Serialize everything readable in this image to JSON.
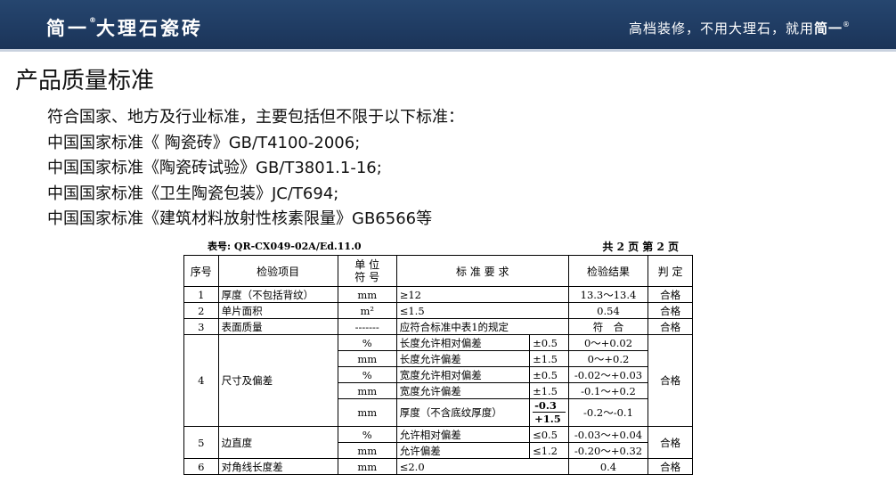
{
  "header": {
    "brand": "简一",
    "brand_tail": "大理石瓷砖",
    "brand_mark": "®",
    "slogan": "高档装修，不用大理石，就用",
    "slogan_brand": "简一",
    "slogan_mark": "®"
  },
  "page_title": "产品质量标准",
  "standards": [
    "符合国家、地方及行业标准，主要包括但不限于以下标准：",
    "中国国家标准《 陶瓷砖》GB/T4100-2006;",
    "中国国家标准《陶瓷砖试验》GB/T3801.1-16;",
    "中国国家标准《卫生陶瓷包装》JC/T694;",
    "中国国家标准《建筑材料放射性核素限量》GB6566等"
  ],
  "report": {
    "form_no": "表号: QR-CX049-02A/Ed.11.0",
    "page_no": "共 2 页 第 2 页",
    "headers": {
      "seq": "序号",
      "item": "检验项目",
      "unit_line1": "单 位",
      "unit_line2": "符 号",
      "requirement": "标 准 要 求",
      "result": "检验结果",
      "judgement": "判 定"
    },
    "rows": {
      "r1": {
        "seq": "1",
        "item": "厚度（不包括背纹）",
        "unit": "mm",
        "requirement": "≥12",
        "result": "13.3～13.4",
        "judgement": "合格"
      },
      "r2": {
        "seq": "2",
        "item": "单片面积",
        "unit": "m²",
        "requirement": "≤1.5",
        "result": "0.54",
        "judgement": "合格"
      },
      "r3": {
        "seq": "3",
        "item": "表面质量",
        "unit": "-------",
        "requirement": "应符合标准中表1的规定",
        "result": "符　合",
        "judgement": "合格"
      },
      "r4": {
        "seq": "4",
        "item": "尺寸及偏差",
        "judgement": "合格",
        "subs": [
          {
            "unit": "%",
            "desc": "长度允许相对偏差",
            "tol": "±0.5",
            "result": "0～+0.02"
          },
          {
            "unit": "mm",
            "desc": "长度允许偏差",
            "tol": "±1.5",
            "result": "0～+0.2"
          },
          {
            "unit": "%",
            "desc": "宽度允许相对偏差",
            "tol": "±0.5",
            "result": "-0.02～+0.03"
          },
          {
            "unit": "mm",
            "desc": "宽度允许偏差",
            "tol": "±1.5",
            "result": "-0.1～+0.2"
          },
          {
            "unit": "mm",
            "desc": "厚度（不含底纹厚度）",
            "tol_top": "-0.3",
            "tol_bottom": "+1.5",
            "result": "-0.2～-0.1"
          }
        ]
      },
      "r5": {
        "seq": "5",
        "item": "边直度",
        "judgement": "合格",
        "subs": [
          {
            "unit": "%",
            "desc": "允许相对偏差",
            "tol": "≤0.5",
            "result": "-0.03～+0.04"
          },
          {
            "unit": "mm",
            "desc": "允许偏差",
            "tol": "≤1.2",
            "result": "-0.20～+0.32"
          }
        ]
      },
      "r6": {
        "seq": "6",
        "item": "对角线长度差",
        "unit": "mm",
        "requirement": "≤2.0",
        "result": "0.4",
        "judgement": "合格"
      }
    }
  },
  "colors": {
    "header_bg": "#1f3b62",
    "header_text": "#ffffff",
    "body_text": "#111111"
  }
}
